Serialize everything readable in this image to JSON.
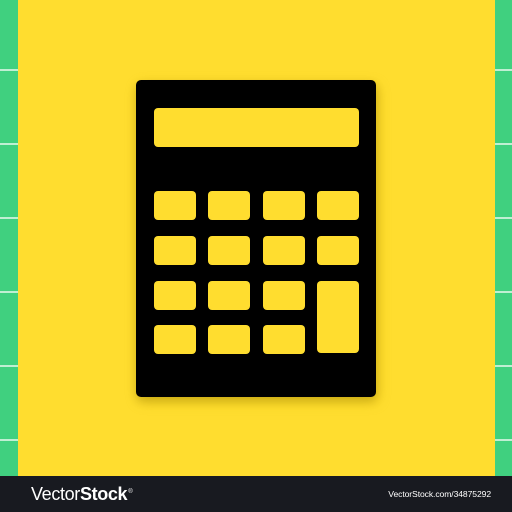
{
  "image": {
    "subject": "calculator",
    "colors": {
      "background": "#ffdd2f",
      "calculator": "#000000",
      "keys": "#ffdd2f",
      "shadow": "#caa700",
      "side_strip": "#40d07f",
      "watermark_bar": "#181a20"
    }
  },
  "watermark": {
    "brand_main": "Vector",
    "brand_stock": "Stock",
    "registered_symbol": "®",
    "url": "VectorStock.com/34875292"
  },
  "icons": [
    "calculator-icon",
    "calculator-display-icon",
    "calculator-key-icon",
    "vectorstock-logo-icon"
  ]
}
